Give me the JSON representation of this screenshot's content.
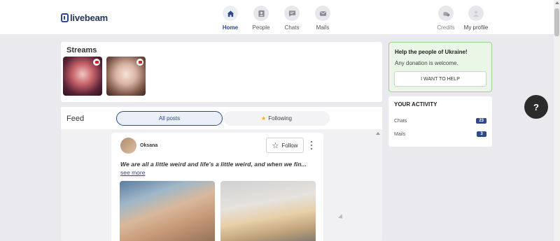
{
  "brand": {
    "logo_text": "livebeam"
  },
  "nav": {
    "items": [
      {
        "label": "Home",
        "icon": "home-icon",
        "active": true
      },
      {
        "label": "People",
        "icon": "people-icon",
        "active": false
      },
      {
        "label": "Chats",
        "icon": "chat-icon",
        "active": false
      },
      {
        "label": "Mails",
        "icon": "mail-icon",
        "active": false
      }
    ],
    "right": [
      {
        "label": "Credits",
        "icon": "credits-icon"
      },
      {
        "label": "My profile",
        "icon": "avatar"
      }
    ]
  },
  "streams": {
    "title": "Streams",
    "count": 2
  },
  "feed": {
    "title": "Feed",
    "tabs": [
      {
        "label": "All posts",
        "active": true
      },
      {
        "label": "Following",
        "active": false
      }
    ],
    "post": {
      "author": "Oksana",
      "follow_label": "Follow",
      "text": "We are all a little weird and life's a little weird, and when we fin...",
      "see_more": "see more"
    }
  },
  "ukraine": {
    "title": "Help the people of Ukraine!",
    "subtitle": "Any donation is welcome.",
    "button": "I WANT TO HELP"
  },
  "activity": {
    "title": "YOUR ACTIVITY",
    "rows": [
      {
        "label": "Chats",
        "count": "23"
      },
      {
        "label": "Mails",
        "count": "3"
      }
    ]
  },
  "help_fab": "?",
  "colors": {
    "brand": "#2f4a8a",
    "ukraine_bg": "#eaf6e6",
    "ukraine_border": "#9fd08d"
  }
}
